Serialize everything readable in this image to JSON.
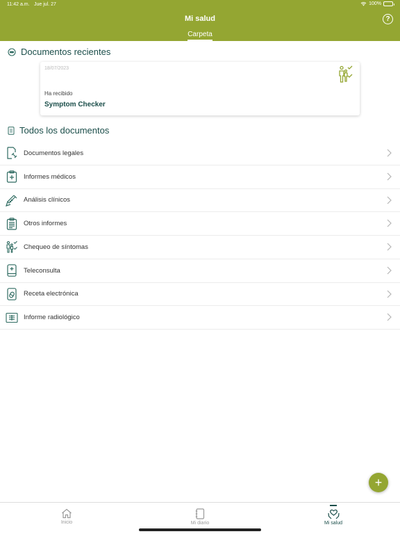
{
  "status": {
    "time": "11:42 a.m.",
    "date": "Jue jul. 27",
    "battery": "100%"
  },
  "header": {
    "title": "Mi salud",
    "help_icon": "question-icon",
    "tab": "Carpeta"
  },
  "recent": {
    "title": "Documentos recientes",
    "icon": "clock-badge-icon"
  },
  "card": {
    "date": "18/07/2023",
    "subtitle": "Ha recibido",
    "name": "Symptom Checker",
    "icon": "symptom-checker-icon"
  },
  "all": {
    "title": "Todos los documentos",
    "icon": "document-icon"
  },
  "list": [
    {
      "label": "Documentos legales",
      "icon": "legal-document-icon"
    },
    {
      "label": "Informes médicos",
      "icon": "medical-report-icon"
    },
    {
      "label": "Análisis clínicos",
      "icon": "syringe-icon"
    },
    {
      "label": "Otros informes",
      "icon": "clipboard-icon"
    },
    {
      "label": "Chequeo de síntomas",
      "icon": "symptom-check-icon"
    },
    {
      "label": "Teleconsulta",
      "icon": "teleconsult-icon"
    },
    {
      "label": "Receta electrónica",
      "icon": "e-prescription-icon"
    },
    {
      "label": "Informe radiológico",
      "icon": "xray-icon"
    }
  ],
  "fab": {
    "label": "+"
  },
  "nav": [
    {
      "label": "Inicio",
      "icon": "home-icon"
    },
    {
      "label": "Mi diario",
      "icon": "diary-icon"
    },
    {
      "label": "Mi salud",
      "icon": "heart-hands-icon"
    }
  ],
  "colors": {
    "brand": "#94a632",
    "accent": "#1b4e4a",
    "icon": "#2f6b61"
  }
}
